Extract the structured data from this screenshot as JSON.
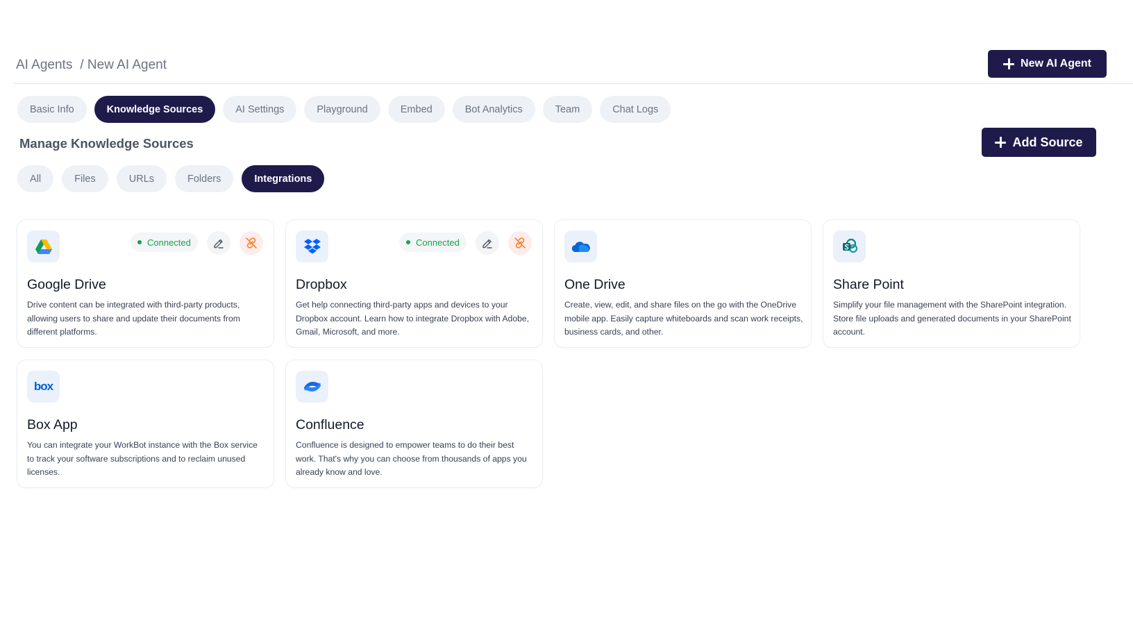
{
  "breadcrumb": {
    "root": "AI Agents",
    "current": "/ New AI Agent"
  },
  "header": {
    "new_agent_label": "New AI Agent"
  },
  "tabs": [
    {
      "label": "Basic Info",
      "active": false
    },
    {
      "label": "Knowledge Sources",
      "active": true
    },
    {
      "label": "AI Settings",
      "active": false
    },
    {
      "label": "Playground",
      "active": false
    },
    {
      "label": "Embed",
      "active": false
    },
    {
      "label": "Bot Analytics",
      "active": false
    },
    {
      "label": "Team",
      "active": false
    },
    {
      "label": "Chat Logs",
      "active": false
    }
  ],
  "section": {
    "title": "Manage Knowledge Sources",
    "add_label": "Add Source"
  },
  "filters": [
    {
      "label": "All",
      "active": false
    },
    {
      "label": "Files",
      "active": false
    },
    {
      "label": "URLs",
      "active": false
    },
    {
      "label": "Folders",
      "active": false
    },
    {
      "label": "Integrations",
      "active": true
    }
  ],
  "integrations": [
    {
      "title": "Google Drive",
      "icon": "google-drive-icon",
      "connected": true,
      "status": "Connected",
      "desc": "Drive content can be integrated with third-party products, allowing users to share and update their documents from different platforms."
    },
    {
      "title": "Dropbox",
      "icon": "dropbox-icon",
      "connected": true,
      "status": "Connected",
      "desc": "Get help connecting third-party apps and devices to your Dropbox account. Learn how to integrate Dropbox with Adobe, Gmail, Microsoft, and more."
    },
    {
      "title": "One Drive",
      "icon": "onedrive-icon",
      "connected": false,
      "desc": "Create, view, edit, and share files on the go with the OneDrive mobile app. Easily capture whiteboards and scan work receipts, business cards, and other."
    },
    {
      "title": "Share Point",
      "icon": "sharepoint-icon",
      "connected": false,
      "desc": "Simplify your file management with the SharePoint integration. Store file uploads and generated documents in your SharePoint account."
    },
    {
      "title": "Box App",
      "icon": "box-icon",
      "connected": false,
      "logo_text": "box",
      "desc": "You can integrate your WorkBot instance with the Box service to track your software subscriptions and to reclaim unused licenses."
    },
    {
      "title": "Confluence",
      "icon": "confluence-icon",
      "connected": false,
      "desc": "Confluence is designed to empower teams to do their best work. That's why you can choose from thousands of apps you already know and love."
    }
  ],
  "colors": {
    "primary": "#1e1b4b",
    "pill_bg": "#eef2f7",
    "connected": "#16a34a",
    "unlink": "#f97316"
  }
}
